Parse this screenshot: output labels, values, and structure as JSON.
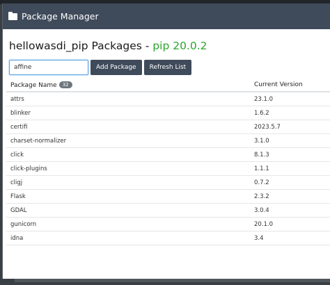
{
  "dialog": {
    "title": "Package Manager",
    "heading_name": "hellowasdi_pip Packages - ",
    "heading_version": "pip 20.0.2"
  },
  "toolbar": {
    "search_value": "affine",
    "add_label": "Add Package",
    "refresh_label": "Refresh List"
  },
  "table": {
    "col_name": "Package Name",
    "count": "32",
    "col_version": "Current Version",
    "rows": [
      {
        "name": "attrs",
        "version": "23.1.0"
      },
      {
        "name": "blinker",
        "version": "1.6.2"
      },
      {
        "name": "certifi",
        "version": "2023.5.7"
      },
      {
        "name": "charset-normalizer",
        "version": "3.1.0"
      },
      {
        "name": "click",
        "version": "8.1.3"
      },
      {
        "name": "click-plugins",
        "version": "1.1.1"
      },
      {
        "name": "cligj",
        "version": "0.7.2"
      },
      {
        "name": "Flask",
        "version": "2.3.2"
      },
      {
        "name": "GDAL",
        "version": "3.0.4"
      },
      {
        "name": "gunicorn",
        "version": "20.1.0"
      },
      {
        "name": "idna",
        "version": "3.4"
      }
    ]
  }
}
